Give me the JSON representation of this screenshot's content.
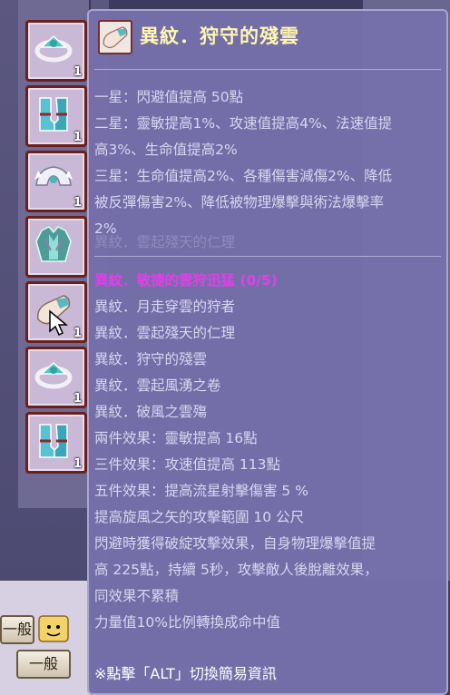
{
  "tooltip": {
    "title": "異紋．狩守的殘雲",
    "tiers": [
      "一星：閃避值提高 50點",
      "二星：靈敏提高1%、攻速值提高4%、法速值提",
      "高3%、生命值提高2%",
      "三星：生命值提高2%、各種傷害減傷2%、降低",
      "被反彈傷害2%、降低被物理爆擊與術法爆擊率",
      "2%"
    ],
    "faded_line": "異紋．雲起殘天的仁理",
    "set_title": "異紋．敏捷的雲狩迅猛 (0/5)",
    "set_items": [
      "異紋．月走穿雲的狩者",
      "異紋．雲起殘天的仁理",
      "異紋．狩守的殘雲",
      "異紋．雲起風湧之卷",
      "異紋．破風之雲殤"
    ],
    "effects": [
      "兩件效果：靈敏提高 16點",
      "三件效果：攻速值提高 113點",
      "五件效果：提高流星射擊傷害 5 %",
      "提高旋風之矢的攻擊範圍 10 公尺",
      "閃避時獲得破綻攻擊效果，自身物理爆擊值提",
      "高 225點，持續 5秒，攻擊敵人後脫離效果，",
      "同效果不累積",
      "力量值10%比例轉換成命中值"
    ],
    "footer": "※點擊「ALT」切換簡易資訊"
  },
  "inventory": {
    "slots": [
      {
        "icon": "tiara-icon",
        "qty": "1"
      },
      {
        "icon": "boots-icon",
        "qty": "1"
      },
      {
        "icon": "winged-helm-icon",
        "qty": "1"
      },
      {
        "icon": "armor-icon",
        "qty": ""
      },
      {
        "icon": "arm-guard-icon",
        "qty": "1"
      },
      {
        "icon": "tiara-icon",
        "qty": "1"
      },
      {
        "icon": "boots-icon",
        "qty": "1"
      }
    ]
  },
  "buttons": {
    "general_1": "一般",
    "general_2": "一般"
  },
  "colors": {
    "tooltip_bg": "#7670aa",
    "title": "#fff6b0",
    "set_title": "#e040e6",
    "text": "#d9d6f0"
  }
}
